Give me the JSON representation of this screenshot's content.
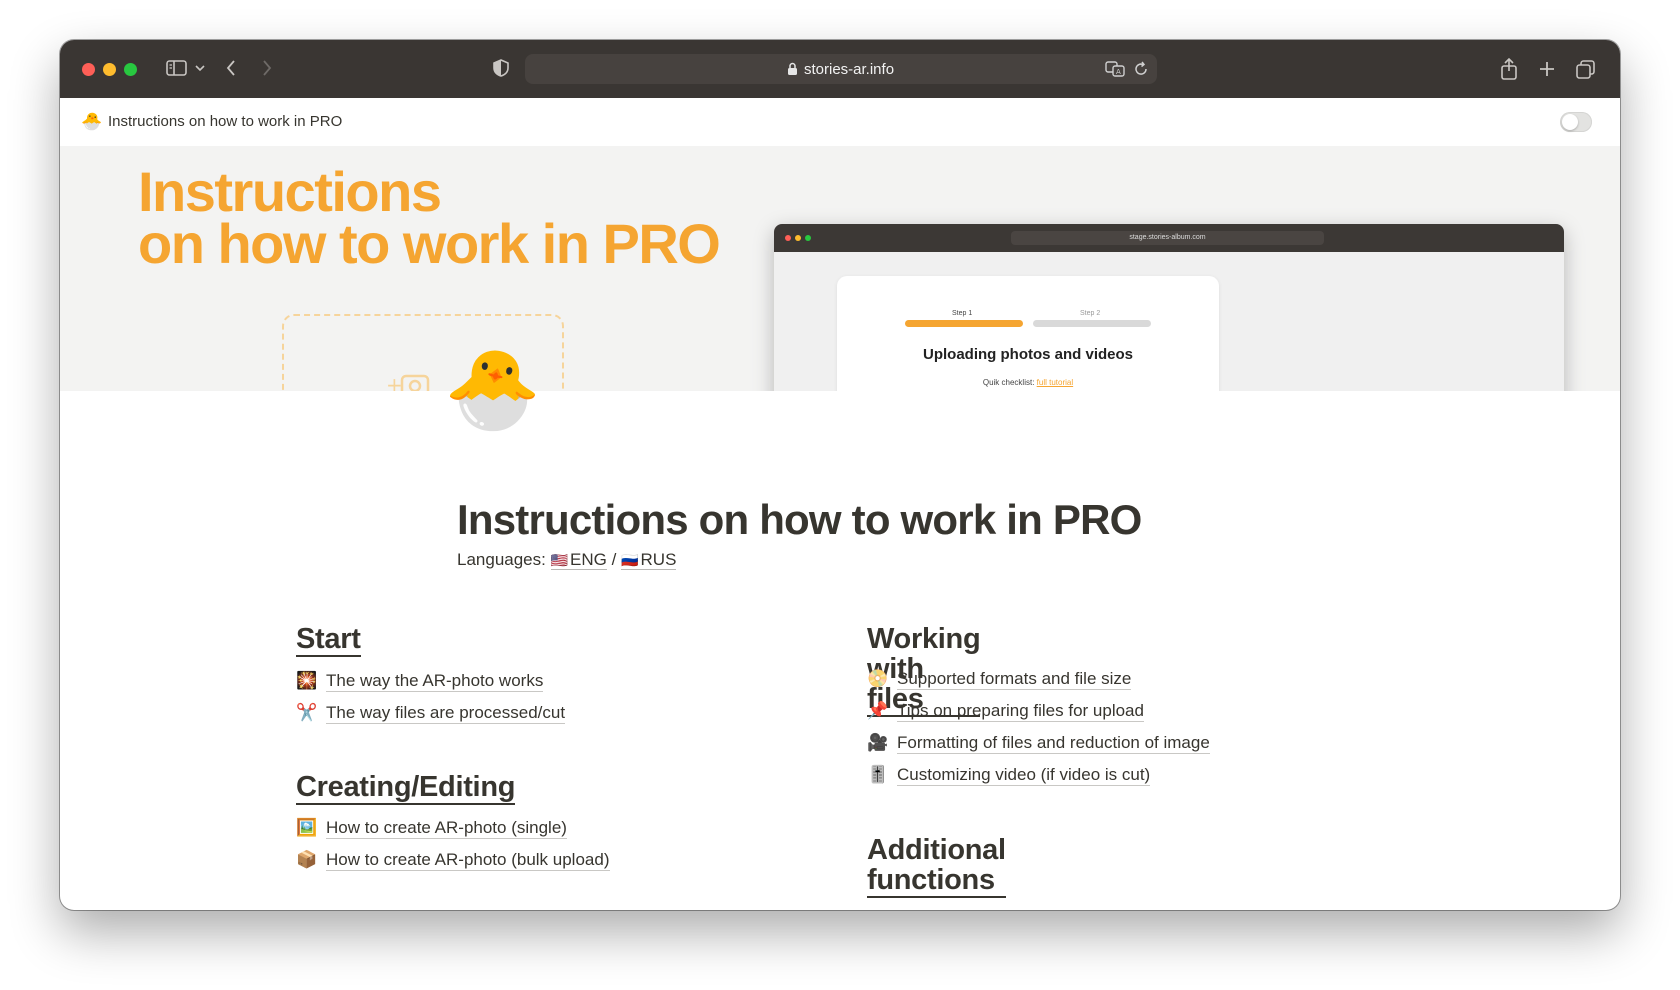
{
  "browser": {
    "url": "stories-ar.info"
  },
  "topbar": {
    "page_emoji": "🐣",
    "breadcrumb": "Instructions on how to work in PRO"
  },
  "cover": {
    "title_line1": "Instructions",
    "title_line2": "on how to work in PRO",
    "mini_browser": {
      "url": "stage.stories-album.com",
      "step1": "Step 1",
      "step2": "Step 2",
      "heading": "Uploading photos and videos",
      "checklist_label": "Quik checklist:",
      "checklist_link": "full tutorial"
    }
  },
  "page": {
    "icon": "🐣",
    "title": "Instructions on how to work in PRO",
    "languages_label": "Languages:",
    "lang_eng_flag": "🇺🇸",
    "lang_eng": "ENG",
    "lang_sep": "/",
    "lang_rus_flag": "🇷🇺",
    "lang_rus": "RUS"
  },
  "sections": {
    "start": {
      "heading": "Start",
      "items": [
        {
          "emoji": "🎇",
          "label": "The way the AR-photo works"
        },
        {
          "emoji": "✂️",
          "label": "The way files are processed/cut"
        }
      ]
    },
    "creating": {
      "heading": "Creating/Editing",
      "items": [
        {
          "emoji": "🖼️",
          "label": "How to create AR-photo (single)"
        },
        {
          "emoji": "📦",
          "label": "How to create AR-photo (bulk upload)"
        }
      ]
    },
    "files": {
      "heading": "Working with files",
      "items": [
        {
          "emoji": "📀",
          "label": "Supported formats and file size"
        },
        {
          "emoji": "📌",
          "label": "Tips on preparing files for upload"
        },
        {
          "emoji": "🎥",
          "label": "Formatting of files and reduction of image"
        },
        {
          "emoji": "🎚️",
          "label": "Customizing video (if video is cut)"
        }
      ]
    },
    "additional": {
      "heading": "Additional functions"
    }
  },
  "colors": {
    "accent": "#f5a531",
    "text": "#37352f",
    "chrome": "#3a3633"
  }
}
